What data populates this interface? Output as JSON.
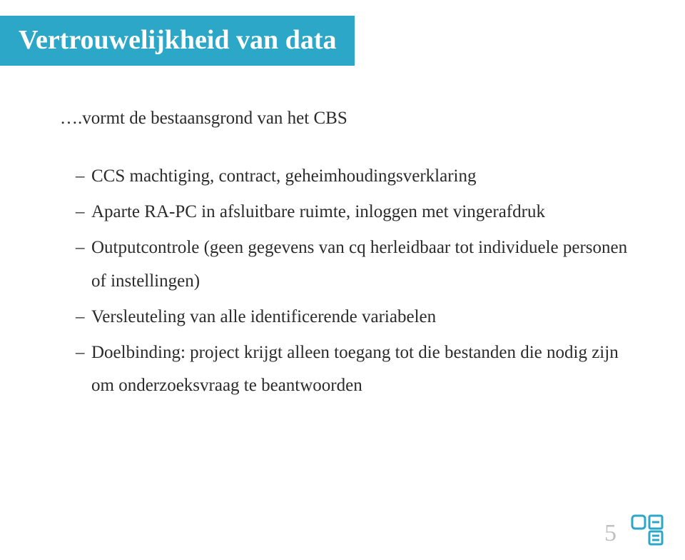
{
  "title": "Vertrouwelijkheid van data",
  "intro": "….vormt de bestaansgrond van het CBS",
  "bullets": [
    "CCS machtiging, contract, geheimhoudingsverklaring",
    "Aparte RA-PC in afsluitbare ruimte, inloggen met vingerafdruk",
    "Outputcontrole (geen gegevens van cq herleidbaar tot individuele personen of instellingen)",
    "Versleuteling van alle identificerende variabelen",
    "Doelbinding: project krijgt alleen toegang tot die bestanden die nodig zijn om onderzoeksvraag te beantwoorden"
  ],
  "page_number": "5",
  "colors": {
    "accent": "#2da7c7",
    "text": "#2b2b2b",
    "muted": "#c0c0c0"
  }
}
